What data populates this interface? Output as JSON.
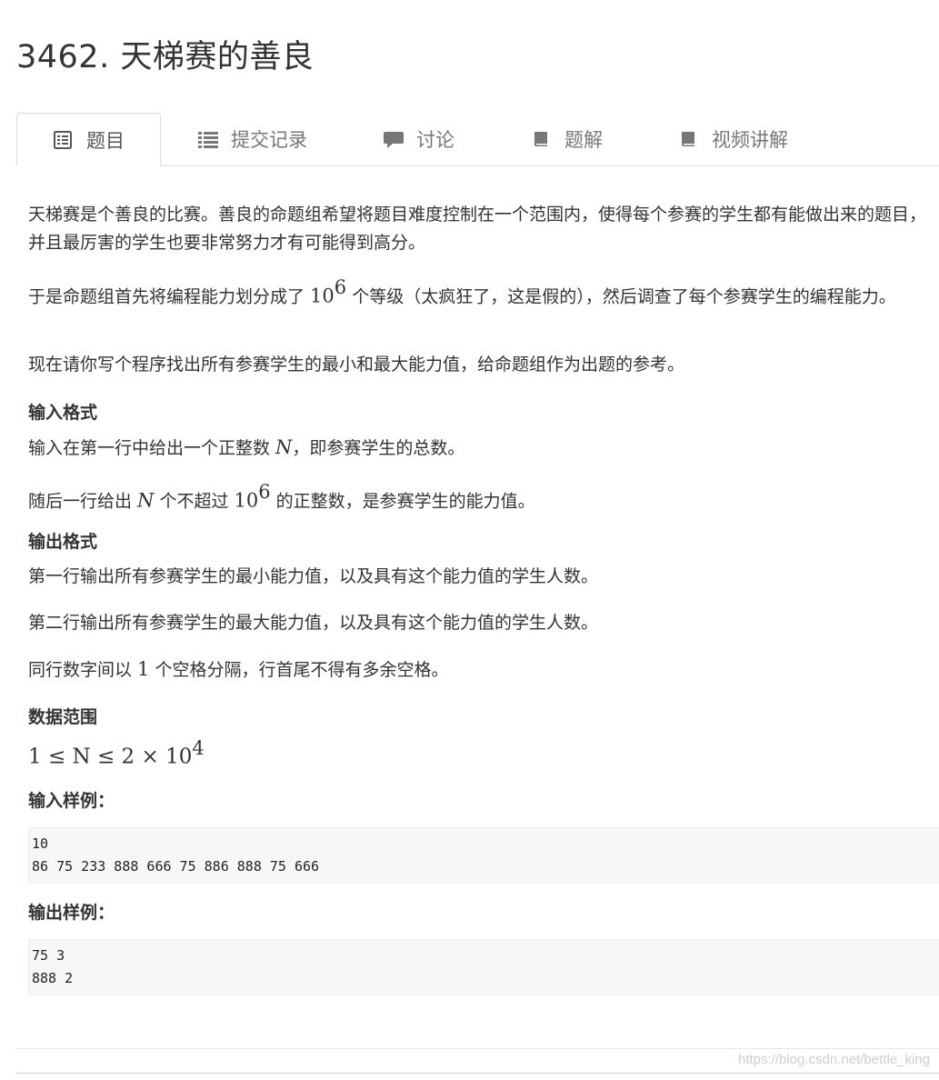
{
  "page": {
    "title": "3462. 天梯赛的善良"
  },
  "tabs": [
    {
      "label": "题目",
      "icon": "doc-icon",
      "active": true
    },
    {
      "label": "提交记录",
      "icon": "list-icon"
    },
    {
      "label": "讨论",
      "icon": "comment-icon"
    },
    {
      "label": "题解",
      "icon": "book-icon"
    },
    {
      "label": "视频讲解",
      "icon": "book-icon"
    }
  ],
  "problem": {
    "p1": "天梯赛是个善良的比赛。善良的命题组希望将题目难度控制在一个范围内，使得每个参赛的学生都有能做出来的题目，并且最厉害的学生也要非常努力才有可能得到高分。",
    "p2_before": "于是命题组首先将编程能力划分成了 ",
    "p2_after": " 个等级（太疯狂了，这是假的），然后调查了每个参赛学生的编程能力。",
    "p3": "现在请你写个程序找出所有参赛学生的最小和最大能力值，给命题组作为出题的参考。",
    "input_heading": "输入格式",
    "input_l1_before": "输入在第一行中给出一个正整数 ",
    "input_l1_after": "，即参赛学生的总数。",
    "input_l2_before": "随后一行给出 ",
    "input_l2_mid": " 个不超过 ",
    "input_l2_after": " 的正整数，是参赛学生的能力值。",
    "output_heading": "输出格式",
    "output_l1": "第一行输出所有参赛学生的最小能力值，以及具有这个能力值的学生人数。",
    "output_l2": "第二行输出所有参赛学生的最大能力值，以及具有这个能力值的学生人数。",
    "output_l3_before": "同行数字间以 ",
    "output_l3_num": "1",
    "output_l3_after": " 个空格分隔，行首尾不得有多余空格。",
    "range_heading": "数据范围",
    "range_formula": "1 ≤ N ≤ 2 × 10",
    "math": {
      "ten": "10",
      "exp6": "6",
      "exp4": "4",
      "N": "N"
    },
    "sample_input_heading": "输入样例：",
    "sample_input_lines": [
      "10",
      "86 75 233 888 666 75 886 888 75 666"
    ],
    "sample_output_heading": "输出样例：",
    "sample_output_lines": [
      "75 3",
      "888 2"
    ]
  },
  "watermark": "https://blog.csdn.net/bettle_king"
}
